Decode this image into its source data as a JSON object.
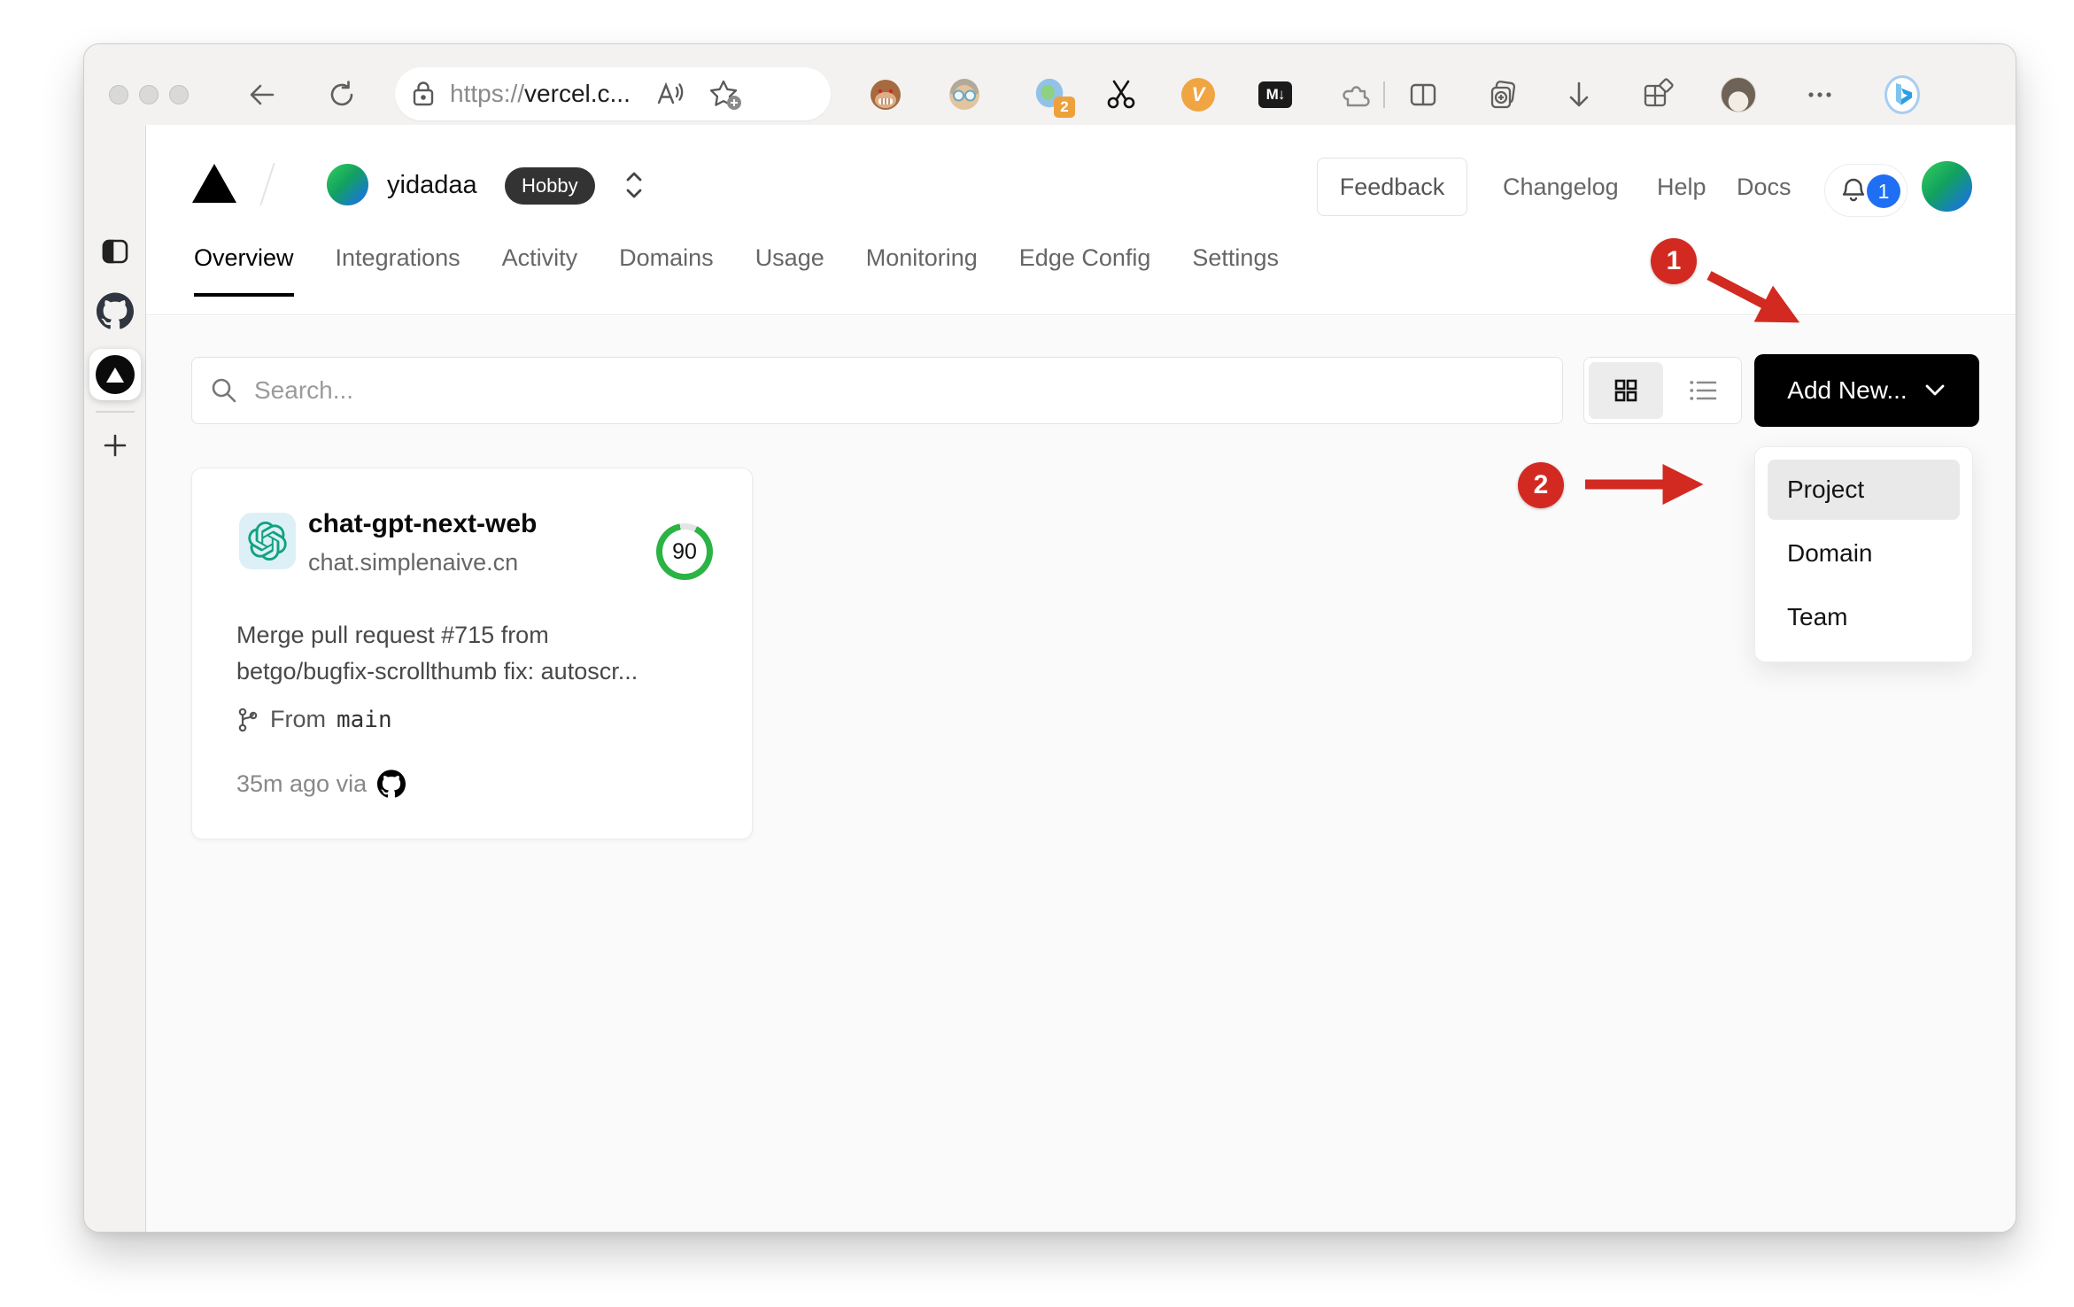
{
  "browser": {
    "url": {
      "scheme": "https://",
      "host": "vercel.c..."
    },
    "extensions": {
      "badge_count": "2",
      "markdown_label": "M↓",
      "v_label": "V"
    },
    "icons": [
      "back-icon",
      "refresh-icon",
      "lock-icon",
      "read-aloud-icon",
      "favorite-add-icon",
      "tampermonkey-icon",
      "person-icon",
      "session-icon",
      "scissors-icon",
      "v-extension-icon",
      "markdown-icon",
      "extensions-puzzle-icon",
      "split-screen-icon",
      "collections-icon",
      "download-icon",
      "apps-layout-icon",
      "profile-avatar",
      "more-icon",
      "bing-icon"
    ]
  },
  "sidebar": {
    "icons": [
      "panel-toggle-icon",
      "github-favicon",
      "vercel-favicon",
      "new-tab-plus-icon"
    ]
  },
  "vercel": {
    "header": {
      "team": "yidadaa",
      "plan": "Hobby",
      "feedback": "Feedback",
      "links": [
        {
          "label": "Changelog"
        },
        {
          "label": "Help"
        },
        {
          "label": "Docs"
        }
      ],
      "notification_count": "1"
    },
    "tabs": [
      {
        "label": "Overview"
      },
      {
        "label": "Integrations"
      },
      {
        "label": "Activity"
      },
      {
        "label": "Domains"
      },
      {
        "label": "Usage"
      },
      {
        "label": "Monitoring"
      },
      {
        "label": "Edge Config"
      },
      {
        "label": "Settings"
      }
    ],
    "toolbar": {
      "search_placeholder": "Search...",
      "add_new_label": "Add New..."
    },
    "dropdown": {
      "items": [
        {
          "label": "Project"
        },
        {
          "label": "Domain"
        },
        {
          "label": "Team"
        }
      ]
    },
    "project_card": {
      "name": "chat-gpt-next-web",
      "domain": "chat.simplenaive.cn",
      "score": "90",
      "commit_line1": "Merge pull request #715 from",
      "commit_line2": "betgo/bugfix-scrollthumb fix: autoscr...",
      "from_label": "From",
      "branch": "main",
      "deployed": "35m ago via"
    },
    "annotations": {
      "step1": "1",
      "step2": "2"
    }
  },
  "colors": {
    "annotation_red": "#d22a21",
    "score_green": "#2bb344",
    "notification_blue": "#1f6ff5",
    "openai_teal": "#10a37f",
    "chrome_bg": "#f3f2f0",
    "body_bg": "#fafafa",
    "button_black": "#000000"
  }
}
